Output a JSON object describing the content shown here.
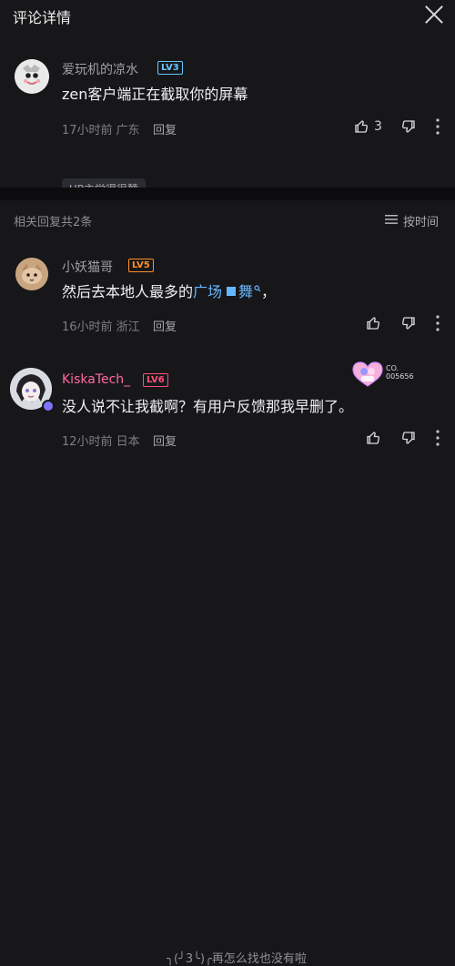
{
  "header": {
    "title": "评论详情"
  },
  "main_comment": {
    "user_name": "爱玩机的凉水",
    "level": "LV3",
    "content": "zen客户端正在截取你的屏幕",
    "meta": "17小时前 广东",
    "reply_label": "回复",
    "like_count": "3",
    "up_badge": "UP主觉得很赞"
  },
  "replies_header": {
    "title": "相关回复共2条",
    "sort_label": "按时间"
  },
  "replies": [
    {
      "user_name": "小妖猫哥",
      "level": "LV5",
      "content_prefix": "然后去本地人最多的",
      "content_link": "广场",
      "content_mid": "舞",
      "content_suffix": "，",
      "meta": "16小时前 浙江",
      "reply_label": "回复"
    },
    {
      "user_name": "KiskaTech_",
      "level": "LV6",
      "content": "没人说不让我截啊？有用户反馈那我早删了。",
      "meta": "12小时前 日本",
      "reply_label": "回复",
      "badge_code": "CO.\n005656"
    }
  ],
  "footer": {
    "text": "╮(╯3╰)╭再怎么找也没有啦"
  },
  "colors": {
    "background": "#17171a",
    "separator": "#0c0c0e",
    "level_blue": "#66c7ff",
    "level_orange": "#ff8f2a",
    "level_pink": "#ff4f78",
    "link_blue": "#66b7ff"
  },
  "icons": {
    "close": "close-icon",
    "like": "thumbs-up-icon",
    "dislike": "thumbs-down-icon",
    "more": "more-vertical-icon",
    "sort": "sort-list-icon",
    "search": "search-mini-icon"
  }
}
